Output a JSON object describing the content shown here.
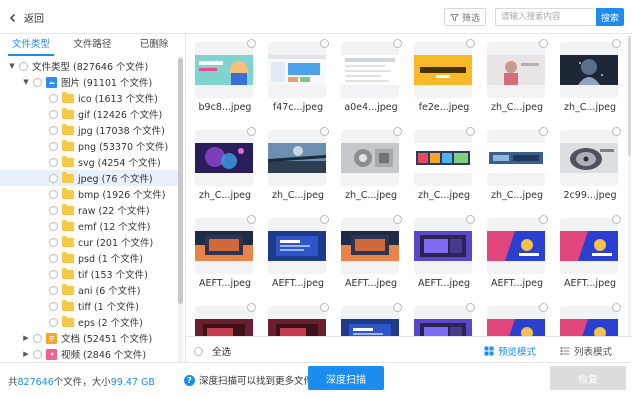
{
  "topbar": {
    "back_label": "返回",
    "filter_label": "筛选",
    "search_placeholder": "请输入搜索内容",
    "search_button": "搜索"
  },
  "tabs": [
    {
      "label": "文件类型",
      "active": true
    },
    {
      "label": "文件路径",
      "active": false
    },
    {
      "label": "已删除",
      "active": false
    }
  ],
  "tree": [
    {
      "label": "文件类型 (827646 个文件)",
      "level": 0,
      "arrow": "down",
      "icon": "none"
    },
    {
      "label": "图片 (91101 个文件)",
      "level": 1,
      "arrow": "down",
      "icon": "image-icon"
    },
    {
      "label": "ico (1613 个文件)",
      "level": 2,
      "arrow": "none",
      "icon": "folder-icon"
    },
    {
      "label": "gif (12426 个文件)",
      "level": 2,
      "arrow": "none",
      "icon": "folder-icon"
    },
    {
      "label": "jpg (17038 个文件)",
      "level": 2,
      "arrow": "none",
      "icon": "folder-icon"
    },
    {
      "label": "png (53370 个文件)",
      "level": 2,
      "arrow": "none",
      "icon": "folder-icon"
    },
    {
      "label": "svg (4254 个文件)",
      "level": 2,
      "arrow": "none",
      "icon": "folder-icon"
    },
    {
      "label": "jpeg (76 个文件)",
      "level": 2,
      "arrow": "none",
      "icon": "folder-icon",
      "selected": true
    },
    {
      "label": "bmp (1926 个文件)",
      "level": 2,
      "arrow": "none",
      "icon": "folder-icon"
    },
    {
      "label": "raw (22 个文件)",
      "level": 2,
      "arrow": "none",
      "icon": "folder-icon"
    },
    {
      "label": "emf (12 个文件)",
      "level": 2,
      "arrow": "none",
      "icon": "folder-icon"
    },
    {
      "label": "cur (201 个文件)",
      "level": 2,
      "arrow": "none",
      "icon": "folder-icon"
    },
    {
      "label": "psd (1 个文件)",
      "level": 2,
      "arrow": "none",
      "icon": "folder-icon"
    },
    {
      "label": "tif (153 个文件)",
      "level": 2,
      "arrow": "none",
      "icon": "folder-icon"
    },
    {
      "label": "ani (6 个文件)",
      "level": 2,
      "arrow": "none",
      "icon": "folder-icon"
    },
    {
      "label": "tiff (1 个文件)",
      "level": 2,
      "arrow": "none",
      "icon": "folder-icon"
    },
    {
      "label": "eps (2 个文件)",
      "level": 2,
      "arrow": "none",
      "icon": "folder-icon"
    },
    {
      "label": "文档 (52451 个文件)",
      "level": 1,
      "arrow": "right",
      "icon": "document-icon"
    },
    {
      "label": "视频 (2846 个文件)",
      "level": 1,
      "arrow": "right",
      "icon": "video-icon"
    }
  ],
  "files": [
    {
      "name": "b9c8...jpeg",
      "thumb": "banner-teal"
    },
    {
      "name": "f47c...jpeg",
      "thumb": "webpage"
    },
    {
      "name": "a0e4...jpeg",
      "thumb": "document"
    },
    {
      "name": "fe2e...jpeg",
      "thumb": "yellow-banner"
    },
    {
      "name": "zh_C...jpeg",
      "thumb": "person-light"
    },
    {
      "name": "zh_C...jpeg",
      "thumb": "dark-figure"
    },
    {
      "name": "zh_C...jpeg",
      "thumb": "purple-cosmic"
    },
    {
      "name": "zh_C...jpeg",
      "thumb": "bridge-sky"
    },
    {
      "name": "zh_C...jpeg",
      "thumb": "gray-machine"
    },
    {
      "name": "zh_C...jpeg",
      "thumb": "colorful-strip"
    },
    {
      "name": "zh_C...jpeg",
      "thumb": "blue-strip"
    },
    {
      "name": "2c99...jpeg",
      "thumb": "hard-drive"
    },
    {
      "name": "AEFT...jpeg",
      "thumb": "sunset-screen"
    },
    {
      "name": "AEFT...jpeg",
      "thumb": "blue-screen"
    },
    {
      "name": "AEFT...jpeg",
      "thumb": "sunset-screen"
    },
    {
      "name": "AEFT...jpeg",
      "thumb": "purple-screen"
    },
    {
      "name": "AEFT...jpeg",
      "thumb": "pink-blue"
    },
    {
      "name": "AEFT...jpeg",
      "thumb": "pink-blue"
    },
    {
      "name": "",
      "thumb": "red-screen"
    },
    {
      "name": "",
      "thumb": "red-screen"
    },
    {
      "name": "",
      "thumb": "blue-screen"
    },
    {
      "name": "",
      "thumb": "purple-screen"
    },
    {
      "name": "",
      "thumb": "pink-blue"
    },
    {
      "name": "",
      "thumb": "pink-blue"
    }
  ],
  "gridbar": {
    "select_all": "全选",
    "preview_mode": "预览模式",
    "list_mode": "列表模式"
  },
  "footer": {
    "prefix": "共",
    "file_count": "827646",
    "mid": "个文件，大小",
    "size": "99.47 GB",
    "hint": "深度扫描可以找到更多文件",
    "deep_scan": "深度扫描",
    "recover": "恢复"
  },
  "colors": {
    "accent": "#1c8cf0",
    "folder": "#f7c94a",
    "disabled": "#dcdcdc"
  }
}
